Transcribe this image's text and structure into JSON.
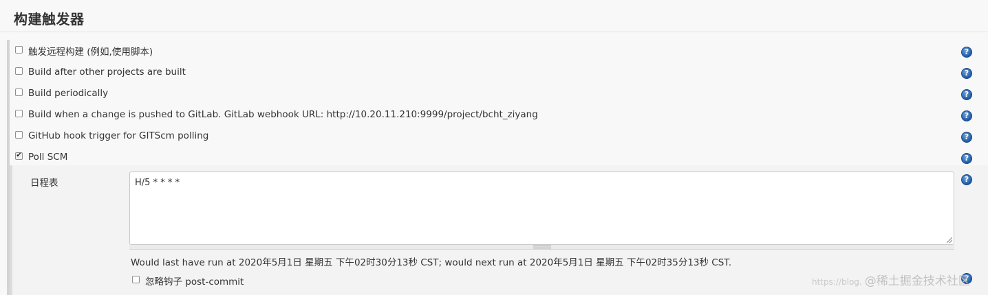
{
  "section": {
    "title": "构建触发器"
  },
  "triggers": [
    {
      "label": "触发远程构建 (例如,使用脚本)",
      "checked": false
    },
    {
      "label": "Build after other projects are built",
      "checked": false
    },
    {
      "label": "Build periodically",
      "checked": false
    },
    {
      "label": "Build when a change is pushed to GitLab. GitLab webhook URL: http://10.20.11.210:9999/project/bcht_ziyang",
      "checked": false
    },
    {
      "label": "GitHub hook trigger for GITScm polling",
      "checked": false
    },
    {
      "label": "Poll SCM",
      "checked": true
    }
  ],
  "poll_scm": {
    "schedule_label": "日程表",
    "schedule_value": "H/5 * * * *",
    "run_info": "Would last have run at 2020年5月1日 星期五 下午02时30分13秒 CST; would next run at 2020年5月1日 星期五 下午02时35分13秒 CST.",
    "ignore_post_commit_label": "忽略钩子 post-commit",
    "ignore_post_commit_checked": false
  },
  "help_icon": {
    "glyph": "?",
    "icon": "help-icon",
    "color": "#1e5aa6"
  },
  "watermark": {
    "small": "https://blog.",
    "main": "@稀土掘金技术社区"
  }
}
